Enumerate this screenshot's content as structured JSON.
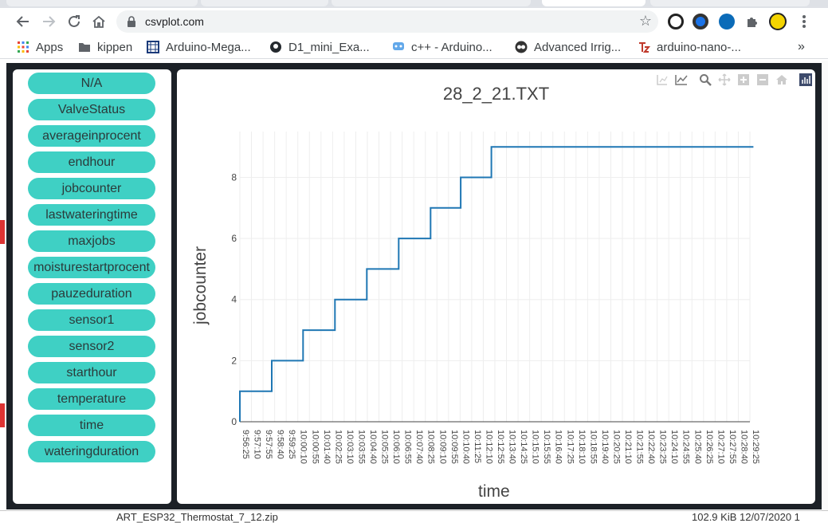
{
  "browser": {
    "url": "csvplot.com",
    "icons": [
      "back-icon",
      "forward-icon",
      "reload-icon",
      "home-icon",
      "lock-icon",
      "star-icon",
      "extension-icon",
      "menu-icon"
    ]
  },
  "bookmarks": [
    {
      "label": "Apps",
      "icon": "apps-grid-icon"
    },
    {
      "label": "kippen",
      "icon": "folder-icon"
    },
    {
      "label": "Arduino-Mega...",
      "icon": "site-icon"
    },
    {
      "label": "D1_mini_Exa...",
      "icon": "github-icon"
    },
    {
      "label": "c++ - Arduino...",
      "icon": "stack-icon"
    },
    {
      "label": "Advanced Irrig...",
      "icon": "instructables-icon"
    },
    {
      "label": "arduino-nano-...",
      "icon": "tz-icon"
    }
  ],
  "bookmarks_more": "»",
  "columns": [
    "N/A",
    "ValveStatus",
    "averageinprocent",
    "endhour",
    "jobcounter",
    "lastwateringtime",
    "maxjobs",
    "moisturestartprocent",
    "pauzeduration",
    "sensor1",
    "sensor2",
    "starthour",
    "temperature",
    "time",
    "wateringduration"
  ],
  "colors": {
    "accent": "#3fd0c4",
    "line": "#1f77b4",
    "frame": "#1c2127"
  },
  "statusbar": {
    "file": "ART_ESP32_Thermostat_7_12.zip",
    "size_date": "102.9 KiB 12/07/2020 1"
  },
  "chart_data": {
    "type": "line",
    "title": "28_2_21.TXT",
    "xlabel": "time",
    "ylabel": "jobcounter",
    "ylim": [
      0,
      9.5
    ],
    "yticks": [
      0,
      2,
      4,
      6,
      8
    ],
    "xticks": [
      "9:56:25",
      "9:57:10",
      "9:57:55",
      "9:58:40",
      "9:59:25",
      "10:00:10",
      "10:00:55",
      "10:01:40",
      "10:02:25",
      "10:03:10",
      "10:03:55",
      "10:04:40",
      "10:05:25",
      "10:06:10",
      "10:06:55",
      "10:07:40",
      "10:08:25",
      "10:09:10",
      "10:09:55",
      "10:10:40",
      "10:11:25",
      "10:12:10",
      "10:12:55",
      "10:13:40",
      "10:14:25",
      "10:15:10",
      "10:15:55",
      "10:16:40",
      "10:17:25",
      "10:18:10",
      "10:18:55",
      "10:19:40",
      "10:20:25",
      "10:21:10",
      "10:21:55",
      "10:22:40",
      "10:23:25",
      "10:24:10",
      "10:24:55",
      "10:25:40",
      "10:26:25",
      "10:27:10",
      "10:27:55",
      "10:28:40",
      "10:29:25"
    ],
    "grid": true,
    "series": [
      {
        "x": [
          0,
          0,
          2.75,
          2.75,
          5.45,
          5.45,
          8.2,
          8.2,
          10.95,
          10.95,
          13.7,
          13.7,
          16.45,
          16.45,
          19.05,
          19.05,
          21.7,
          21.7,
          44.3
        ],
        "y": [
          0,
          1,
          1,
          2,
          2,
          3,
          3,
          4,
          4,
          5,
          5,
          6,
          6,
          7,
          7,
          8,
          8,
          9,
          9
        ]
      }
    ]
  }
}
